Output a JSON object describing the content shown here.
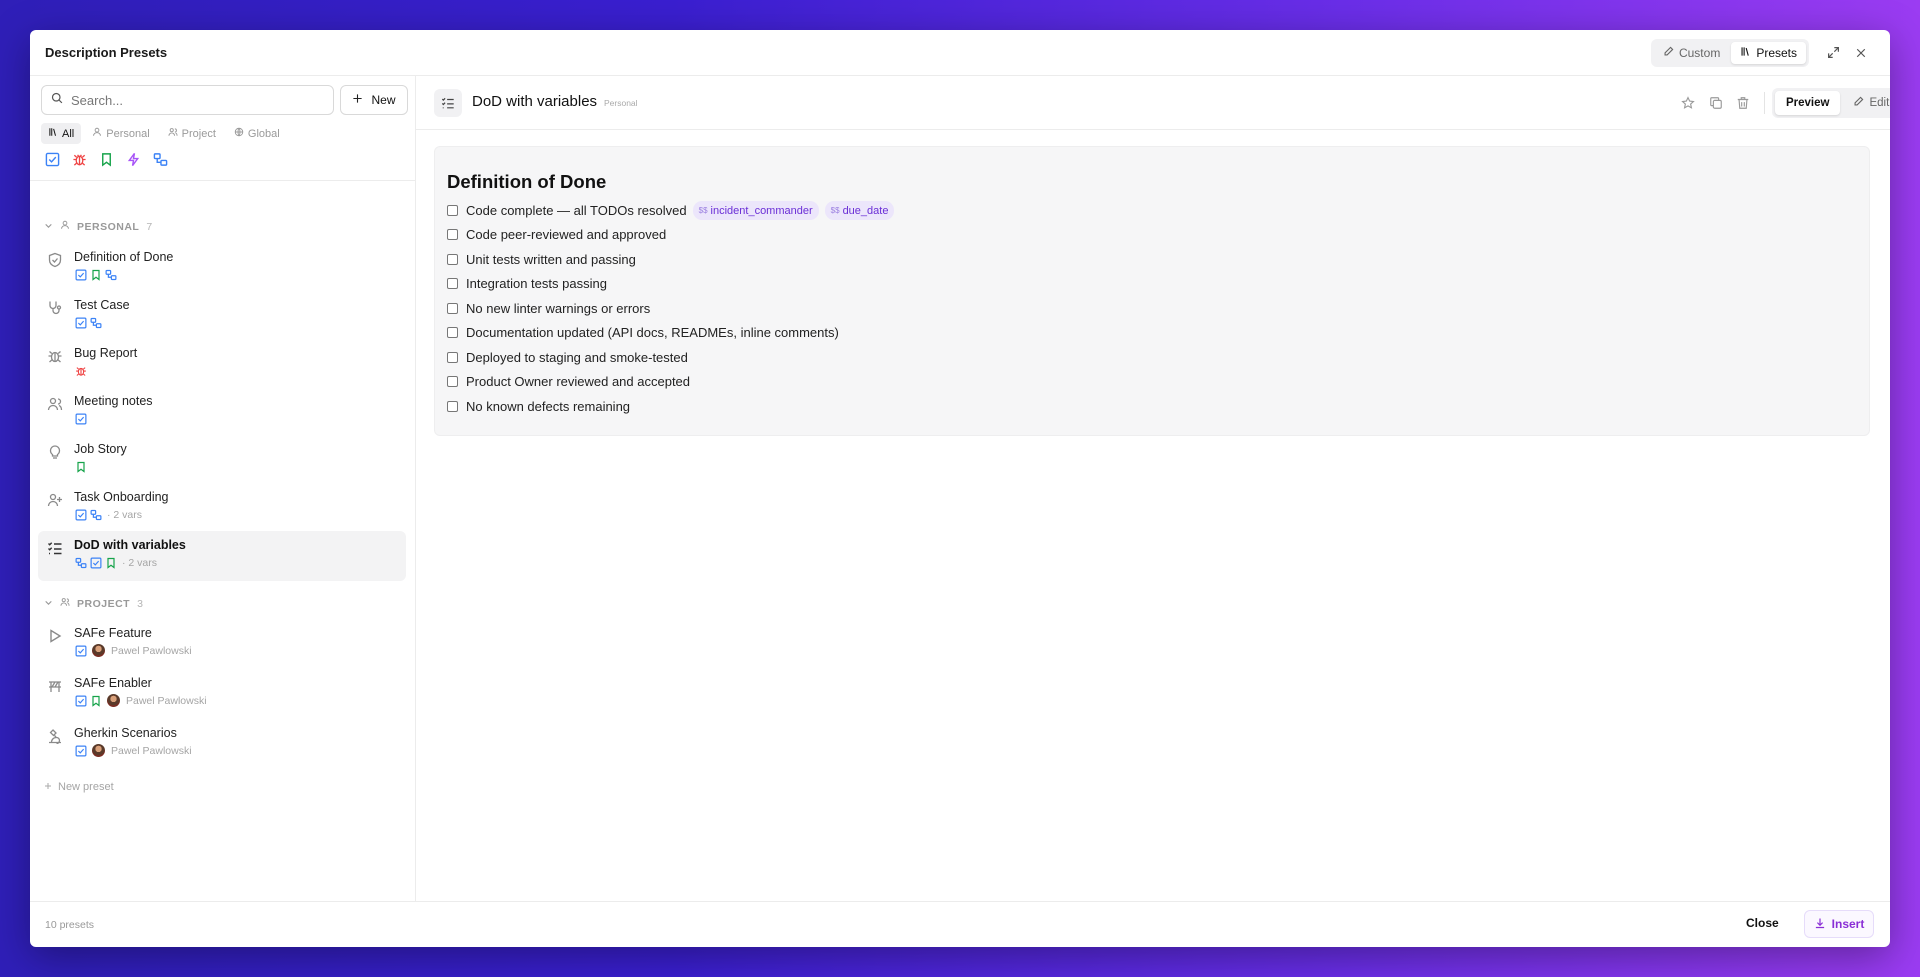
{
  "modal": {
    "title": "Description Presets",
    "mode_tabs": [
      {
        "label": "Custom",
        "active": false
      },
      {
        "label": "Presets",
        "active": true
      }
    ]
  },
  "sidebar": {
    "search_placeholder": "Search...",
    "new_label": "New",
    "filters": [
      {
        "label": "All",
        "active": true
      },
      {
        "label": "Personal",
        "active": false
      },
      {
        "label": "Project",
        "active": false
      },
      {
        "label": "Global",
        "active": false
      }
    ],
    "type_icons": [
      "checkbox-icon",
      "bug-icon",
      "bookmark-icon",
      "bolt-icon",
      "link-icon"
    ],
    "groups": [
      {
        "label": "PERSONAL",
        "count": "7",
        "items": [
          {
            "name": "Definition of Done",
            "icon": "shield-check-icon"
          },
          {
            "name": "Test Case",
            "icon": "stethoscope-icon"
          },
          {
            "name": "Bug Report",
            "icon": "bug-icon"
          },
          {
            "name": "Meeting notes",
            "icon": "users-icon"
          },
          {
            "name": "Job Story",
            "icon": "lightbulb-icon"
          },
          {
            "name": "Task Onboarding",
            "icon": "user-plus-icon",
            "vars": "· 2 vars"
          },
          {
            "name": "DoD with variables",
            "icon": "list-check-icon",
            "vars": "· 2 vars",
            "selected": true
          }
        ]
      },
      {
        "label": "PROJECT",
        "count": "3",
        "items": [
          {
            "name": "SAFe Feature",
            "icon": "play-icon",
            "author": "Pawel Pawlowski"
          },
          {
            "name": "SAFe Enabler",
            "icon": "signpost-icon",
            "author": "Pawel Pawlowski"
          },
          {
            "name": "Gherkin Scenarios",
            "icon": "microscope-icon",
            "author": "Pawel Pawlowski"
          }
        ]
      }
    ],
    "new_preset_label": "New preset"
  },
  "main": {
    "title": "DoD with variables",
    "badge": "Personal",
    "actions": [
      "star-icon",
      "duplicate-icon",
      "trash-icon"
    ],
    "view_tabs": [
      {
        "label": "Preview",
        "active": true
      },
      {
        "label": "Edit",
        "active": false
      }
    ],
    "preview": {
      "heading": "Definition of Done",
      "checklist": [
        {
          "text": "Code complete — all TODOs resolved",
          "vars": [
            "incident_commander",
            "due_date"
          ]
        },
        {
          "text": "Code peer-reviewed and approved"
        },
        {
          "text": "Unit tests written and passing"
        },
        {
          "text": "Integration tests passing"
        },
        {
          "text": "No new linter warnings or errors"
        },
        {
          "text": "Documentation updated (API docs, READMEs, inline comments)"
        },
        {
          "text": "Deployed to staging and smoke-tested"
        },
        {
          "text": "Product Owner reviewed and accepted"
        },
        {
          "text": "No known defects remaining"
        }
      ],
      "var_prefix": "$$"
    }
  },
  "footer": {
    "count_label": "10 presets",
    "close_label": "Close",
    "insert_label": "Insert"
  },
  "colors": {
    "accent": "#8a2fd6",
    "chip_bg": "#ece6fb",
    "checkbox_blue": "#3b82f6",
    "bug_red": "#ef4444",
    "bookmark_green": "#16a34a",
    "bolt_purple": "#a855f7"
  }
}
